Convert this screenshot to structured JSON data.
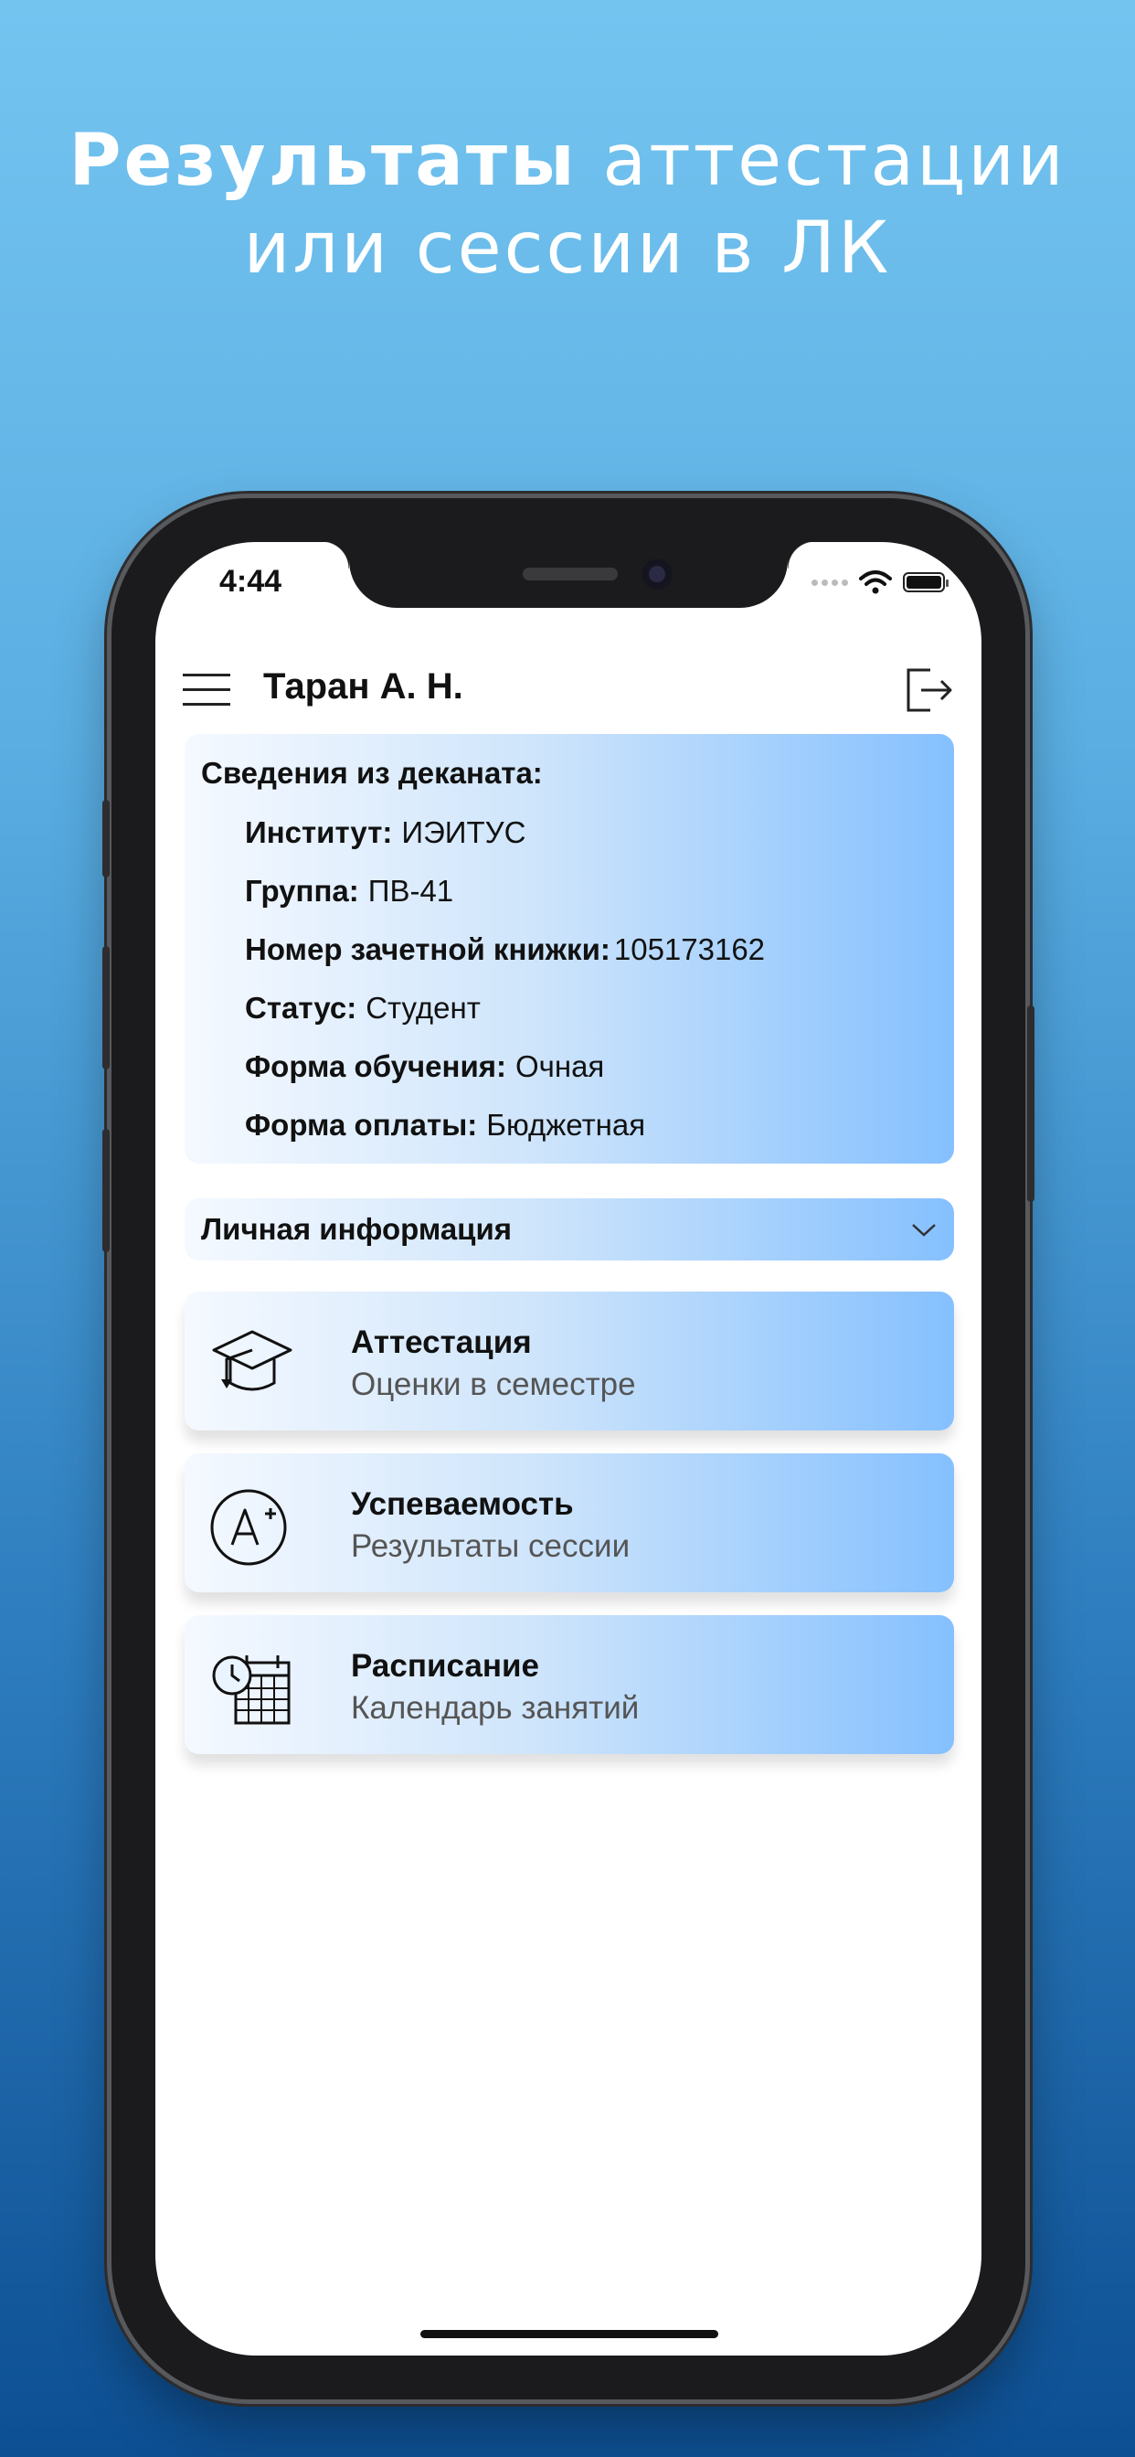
{
  "promo": {
    "headline_bold": "Результаты",
    "headline_rest": " аттестации",
    "headline_line2": "или сессии в ЛК"
  },
  "status_bar": {
    "time": "4:44"
  },
  "header": {
    "title": "Таран А. Н."
  },
  "dean_info": {
    "title": "Сведения из деканата:",
    "rows": [
      {
        "label": "Институт:",
        "value": "ИЭИТУС"
      },
      {
        "label": "Группа:",
        "value": "ПВ-41"
      },
      {
        "label": "Номер зачетной книжки:",
        "value": "105173162"
      },
      {
        "label": "Статус:",
        "value": "Студент"
      },
      {
        "label": "Форма обучения:",
        "value": "Очная"
      },
      {
        "label": "Форма оплаты:",
        "value": "Бюджетная"
      }
    ]
  },
  "personal": {
    "label": "Личная информация"
  },
  "menu": [
    {
      "title": "Аттестация",
      "subtitle": "Оценки в семестре",
      "icon": "graduation-cap-icon"
    },
    {
      "title": "Успеваемость",
      "subtitle": "Результаты сессии",
      "icon": "grade-a-plus-icon"
    },
    {
      "title": "Расписание",
      "subtitle": "Календарь занятий",
      "icon": "calendar-clock-icon"
    }
  ],
  "colors": {
    "background_top": "#74c4f0",
    "background_bottom": "#0d4f93",
    "card_gradient_end": "#85c0ff"
  }
}
